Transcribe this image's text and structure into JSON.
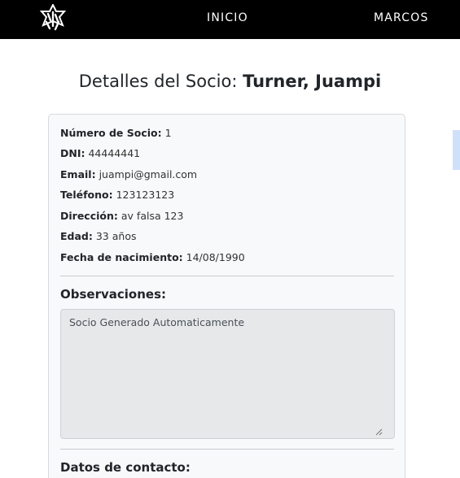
{
  "nav": {
    "logo_icon": "club-logo-icon",
    "items": [
      {
        "label": "INICIO"
      },
      {
        "label": "MARCOS"
      }
    ]
  },
  "page": {
    "title_prefix": "Detalles del Socio: ",
    "title_name": "Turner, Juampi"
  },
  "socio": {
    "fields": [
      {
        "label": "Número de Socio:",
        "value": "1"
      },
      {
        "label": "DNI:",
        "value": "44444441"
      },
      {
        "label": "Email:",
        "value": "juampi@gmail.com"
      },
      {
        "label": "Teléfono:",
        "value": "123123123"
      },
      {
        "label": "Dirección:",
        "value": "av falsa 123"
      },
      {
        "label": "Edad:",
        "value": "33 años"
      },
      {
        "label": "Fecha de nacimiento:",
        "value": "14/08/1990"
      }
    ],
    "observaciones_title": "Observaciones:",
    "observaciones_text": "Socio Generado Automaticamente",
    "contacto_title": "Datos de contacto:"
  },
  "colors": {
    "navbar": "#000000",
    "card_bg": "#f8f9fa",
    "textarea_bg": "#e6e8ea",
    "accent": "#cfe0fb"
  }
}
